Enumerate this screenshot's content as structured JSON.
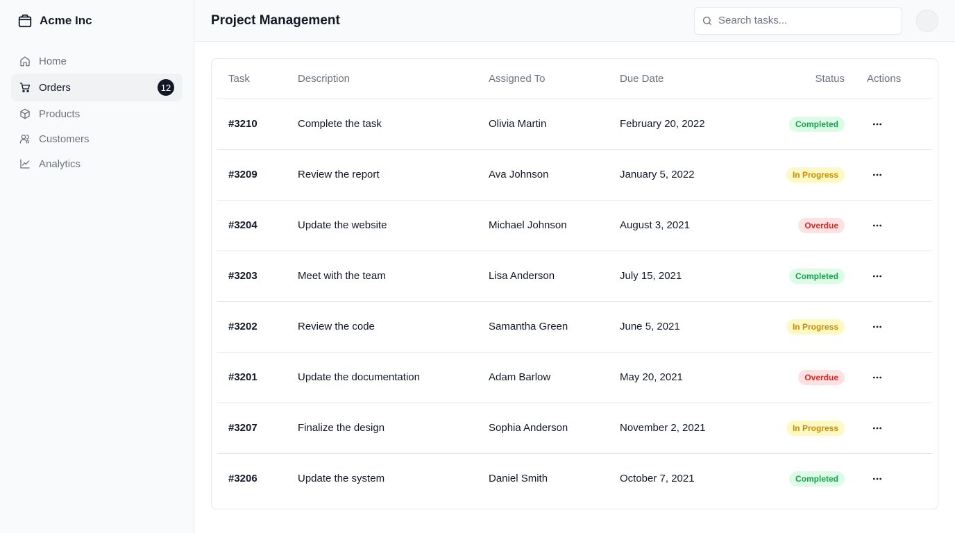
{
  "brand": {
    "name": "Acme Inc",
    "icon": "package-icon"
  },
  "sidebar": {
    "items": [
      {
        "label": "Home",
        "icon": "home-icon"
      },
      {
        "label": "Orders",
        "icon": "cart-icon",
        "badge": "12",
        "active": true
      },
      {
        "label": "Products",
        "icon": "box-icon"
      },
      {
        "label": "Customers",
        "icon": "users-icon"
      },
      {
        "label": "Analytics",
        "icon": "line-chart-icon"
      }
    ]
  },
  "header": {
    "title": "Project Management",
    "search": {
      "placeholder": "Search tasks...",
      "value": ""
    }
  },
  "table": {
    "columns": [
      "Task",
      "Description",
      "Assigned To",
      "Due Date",
      "Status",
      "Actions"
    ],
    "rows": [
      {
        "task": "#3210",
        "description": "Complete the task",
        "assigned": "Olivia Martin",
        "due": "February 20, 2022",
        "status": "Completed"
      },
      {
        "task": "#3209",
        "description": "Review the report",
        "assigned": "Ava Johnson",
        "due": "January 5, 2022",
        "status": "In Progress"
      },
      {
        "task": "#3204",
        "description": "Update the website",
        "assigned": "Michael Johnson",
        "due": "August 3, 2021",
        "status": "Overdue"
      },
      {
        "task": "#3203",
        "description": "Meet with the team",
        "assigned": "Lisa Anderson",
        "due": "July 15, 2021",
        "status": "Completed"
      },
      {
        "task": "#3202",
        "description": "Review the code",
        "assigned": "Samantha Green",
        "due": "June 5, 2021",
        "status": "In Progress"
      },
      {
        "task": "#3201",
        "description": "Update the documentation",
        "assigned": "Adam Barlow",
        "due": "May 20, 2021",
        "status": "Overdue"
      },
      {
        "task": "#3207",
        "description": "Finalize the design",
        "assigned": "Sophia Anderson",
        "due": "November 2, 2021",
        "status": "In Progress"
      },
      {
        "task": "#3206",
        "description": "Update the system",
        "assigned": "Daniel Smith",
        "due": "October 7, 2021",
        "status": "Completed"
      }
    ]
  },
  "colors": {
    "completed_bg": "#dcfce7",
    "completed_fg": "#16a34a",
    "in_progress_bg": "#fef9c3",
    "in_progress_fg": "#ca8a04",
    "overdue_bg": "#fee2e2",
    "overdue_fg": "#dc2626",
    "badge_bg": "#111827"
  }
}
